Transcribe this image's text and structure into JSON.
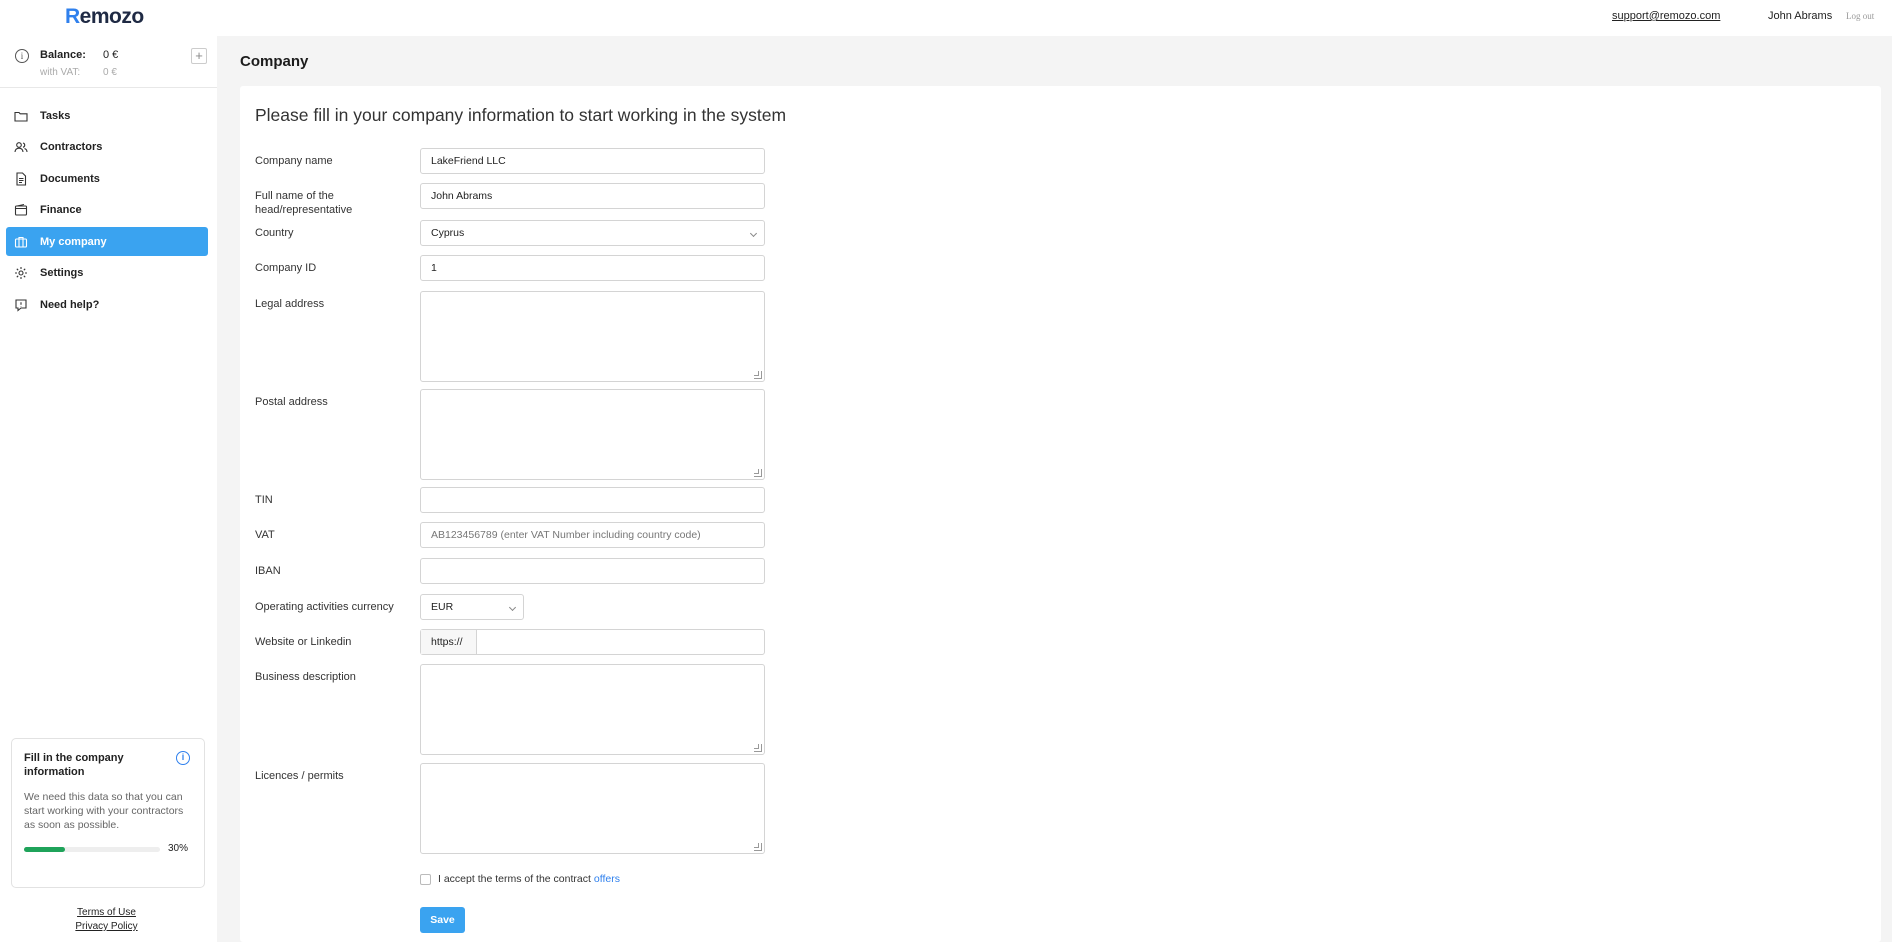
{
  "header": {
    "logo": "Remozo",
    "support_email": "support@remozo.com",
    "user_name": "John Abrams",
    "logout_label": "Log out"
  },
  "sidebar": {
    "balance": {
      "label": "Balance:",
      "value": "0 €",
      "vat_label": "with VAT:",
      "vat_value": "0 €",
      "add_label": "+"
    },
    "items": [
      {
        "label": "Tasks",
        "icon": "folder-icon"
      },
      {
        "label": "Contractors",
        "icon": "users-icon"
      },
      {
        "label": "Documents",
        "icon": "document-icon"
      },
      {
        "label": "Finance",
        "icon": "wallet-icon"
      },
      {
        "label": "My company",
        "icon": "briefcase-icon",
        "active": true
      },
      {
        "label": "Settings",
        "icon": "gear-icon"
      },
      {
        "label": "Need help?",
        "icon": "help-chat-icon"
      }
    ],
    "promo": {
      "title": "Fill in the company information",
      "description": "We need this data so that you can start working with your contractors as soon as possible.",
      "progress_percent": 30,
      "progress_label": "30%"
    },
    "legal": {
      "terms": "Terms of Use",
      "privacy": "Privacy Policy"
    }
  },
  "main": {
    "page_title": "Company",
    "heading": "Please fill in your company information to start working in the system",
    "form": {
      "company_name": {
        "label": "Company name",
        "value": "LakeFriend LLC"
      },
      "head_name": {
        "label": "Full name of the head/representative",
        "value": "John Abrams"
      },
      "country": {
        "label": "Country",
        "value": "Cyprus"
      },
      "company_id": {
        "label": "Company ID",
        "value": "1"
      },
      "legal_address": {
        "label": "Legal address",
        "value": ""
      },
      "postal_address": {
        "label": "Postal address",
        "value": ""
      },
      "tin": {
        "label": "TIN",
        "value": ""
      },
      "vat": {
        "label": "VAT",
        "placeholder": "AB123456789 (enter VAT Number including country code)"
      },
      "iban": {
        "label": "IBAN",
        "value": ""
      },
      "currency": {
        "label": "Operating activities currency",
        "value": "EUR"
      },
      "website": {
        "label": "Website or Linkedin",
        "prefix": "https://",
        "value": ""
      },
      "business_description": {
        "label": "Business description",
        "value": ""
      },
      "licences": {
        "label": "Licences / permits",
        "value": ""
      }
    },
    "accept": {
      "text": "I accept the terms of the contract",
      "link": "offers"
    },
    "save_label": "Save"
  },
  "colors": {
    "accent": "#3aa3f0",
    "link": "#2f80ed",
    "progress": "#1fa35a"
  }
}
